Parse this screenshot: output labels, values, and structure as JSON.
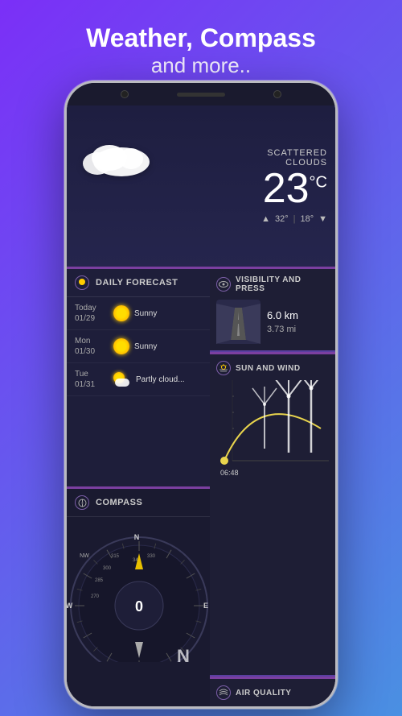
{
  "header": {
    "title": "Weather, Compass",
    "subtitle": "and more.."
  },
  "weather": {
    "condition": "SCATTERED CLOUDS",
    "temperature": "23",
    "unit": "°C",
    "high": "32°",
    "low": "18°"
  },
  "forecast": {
    "header": "DAILY FORECAST",
    "days": [
      {
        "label": "Today",
        "date": "01/29",
        "condition": "Sunny"
      },
      {
        "label": "Mon",
        "date": "01/30",
        "condition": "Sunny"
      },
      {
        "label": "Tue",
        "date": "01/31",
        "condition": "Partly cloud..."
      }
    ]
  },
  "compass": {
    "header": "COMPASS",
    "value": "0"
  },
  "visibility": {
    "header": "VISIBILITY AND PRESS",
    "km": "6.0 km",
    "mi": "3.73 mi"
  },
  "sun_wind": {
    "header": "SUN AND WIND",
    "time": "06:48"
  },
  "air_quality": {
    "header": "AIR QUALITY"
  },
  "icons": {
    "weather_icon": "cloud",
    "forecast_icon": "calendar",
    "compass_icon": "compass",
    "visibility_icon": "eye",
    "sun_wind_icon": "sun-wind",
    "air_quality_icon": "air"
  }
}
